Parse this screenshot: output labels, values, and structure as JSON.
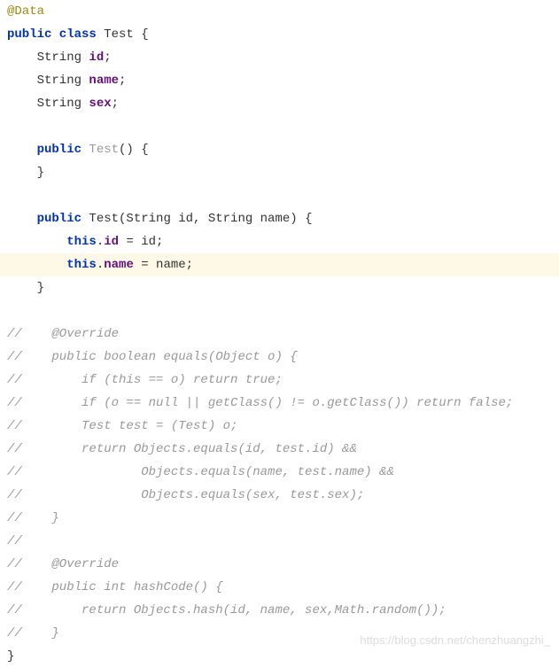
{
  "code": {
    "l1_annotation": "@Data",
    "l2_a": "public class ",
    "l2_b": "Test {",
    "l3_a": "    String ",
    "l3_b": "id",
    "l3_c": ";",
    "l4_a": "    String ",
    "l4_b": "name",
    "l4_c": ";",
    "l5_a": "    String ",
    "l5_b": "sex",
    "l5_c": ";",
    "l6": "",
    "l7_a": "    public ",
    "l7_b": "Test",
    "l7_c": "() {",
    "l8": "    }",
    "l9": "",
    "l10_a": "    public ",
    "l10_b": "Test",
    "l10_c": "(String id, String name) {",
    "l11_a": "        this",
    "l11_b": ".",
    "l11_c": "id ",
    "l11_d": "= id;",
    "l12_a": "        this",
    "l12_b": ".",
    "l12_c": "name ",
    "l12_d": "= name;",
    "l13": "    }",
    "l14": "",
    "l15": "//    @Override",
    "l16": "//    public boolean equals(Object o) {",
    "l17": "//        if (this == o) return true;",
    "l18": "//        if (o == null || getClass() != o.getClass()) return false;",
    "l19": "//        Test test = (Test) o;",
    "l20": "//        return Objects.equals(id, test.id) &&",
    "l21": "//                Objects.equals(name, test.name) &&",
    "l22": "//                Objects.equals(sex, test.sex);",
    "l23": "//    }",
    "l24": "//",
    "l25": "//    @Override",
    "l26": "//    public int hashCode() {",
    "l27": "//        return Objects.hash(id, name, sex,Math.random());",
    "l28": "//    }",
    "l29": "}"
  },
  "watermark": "https://blog.csdn.net/chenzhuangzhi_"
}
